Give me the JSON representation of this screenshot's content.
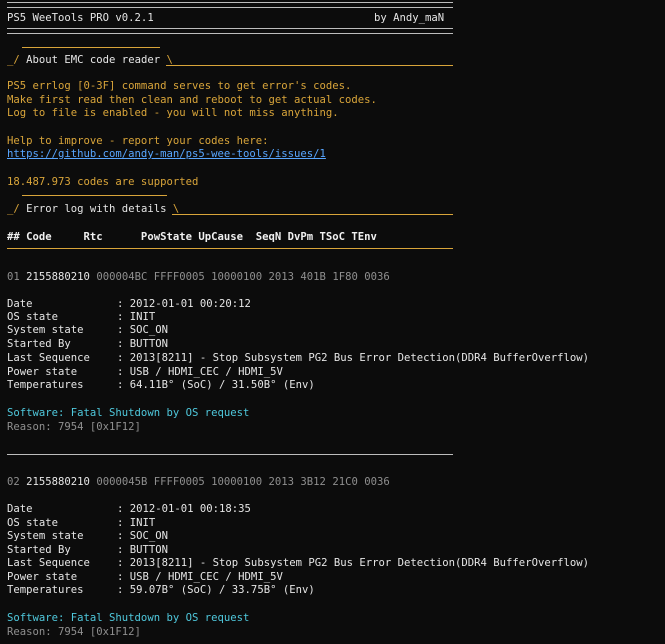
{
  "header": {
    "title": "PS5 WeeTools PRO v0.2.1",
    "author": "by Andy_maN"
  },
  "about": {
    "heading": "About EMC code reader",
    "lines": [
      "PS5 errlog [0-3F] command serves to get error's codes.",
      "Make first read then clean and reboot to get actual codes.",
      "Log to file is enabled - you will not miss anything."
    ],
    "help_text": "Help to improve - report your codes here:",
    "help_link": "https://github.com/andy-man/ps5-wee-tools/issues/1",
    "supported": "18.487.973 codes are supported"
  },
  "errlog": {
    "heading": "Error log with details",
    "columns": "## Code     Rtc      PowState UpCause  SeqN DvPm TSoC TEnv",
    "labels": {
      "date": "Date",
      "os": "OS state",
      "system": "System state",
      "started": "Started By",
      "sequence": "Last Sequence",
      "power": "Power state",
      "temps": "Temperatures"
    },
    "entries": [
      {
        "num": "01",
        "code": "2155880210",
        "rest": "000004BC FFFF0005 10000100 2013 401B 1F80 0036",
        "date": ": 2012-01-01 00:20:12",
        "os": ": INIT",
        "system": ": SOC_ON",
        "started": ": BUTTON",
        "sequence": ": 2013[8211] - Stop Subsystem PG2 Bus Error Detection(DDR4 BufferOverflow)",
        "power": ": USB / HDMI_CEC / HDMI_5V",
        "temps": ": 64.11B° (SoC) / 31.50B° (Env)",
        "software": "Software: Fatal Shutdown by OS request",
        "reason": "Reason: 7954 [0x1F12]"
      },
      {
        "num": "02",
        "code": "2155880210",
        "rest": "0000045B FFFF0005 10000100 2013 3B12 21C0 0036",
        "date": ": 2012-01-01 00:18:35",
        "os": ": INIT",
        "system": ": SOC_ON",
        "started": ": BUTTON",
        "sequence": ": 2013[8211] - Stop Subsystem PG2 Bus Error Detection(DDR4 BufferOverflow)",
        "power": ": USB / HDMI_CEC / HDMI_5V",
        "temps": ": 59.07B° (SoC) / 33.75B° (Env)",
        "software": "Software: Fatal Shutdown by OS request",
        "reason": "Reason: 7954 [0x1F12]"
      }
    ]
  }
}
